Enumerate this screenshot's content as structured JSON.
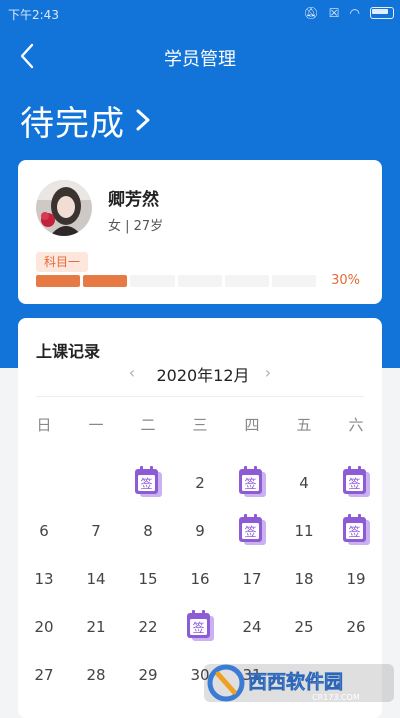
{
  "status_bar": {
    "time": "下午2:43"
  },
  "header": {
    "title": "学员管理"
  },
  "section": {
    "status_label": "待完成"
  },
  "student": {
    "name": "卿芳然",
    "info": "女 | 27岁",
    "subject": "科目一",
    "progress_percent": "30%",
    "progress_fraction": 0.3,
    "segments_total": 6,
    "segments_filled": 2
  },
  "records": {
    "title": "上课记录",
    "month": "2020年12月",
    "weekdays": [
      "日",
      "一",
      "二",
      "三",
      "四",
      "五",
      "六"
    ],
    "weeks": [
      [
        "",
        "",
        "1",
        "2",
        "3",
        "4",
        "5"
      ],
      [
        "6",
        "7",
        "8",
        "9",
        "10",
        "11",
        "12"
      ],
      [
        "13",
        "14",
        "15",
        "16",
        "17",
        "18",
        "19"
      ],
      [
        "20",
        "21",
        "22",
        "23",
        "24",
        "25",
        "26"
      ],
      [
        "27",
        "28",
        "29",
        "30",
        "31",
        "",
        ""
      ]
    ],
    "signed_days": [
      "1",
      "3",
      "5",
      "10",
      "12",
      "23"
    ],
    "sign_label": "签"
  },
  "watermark": {
    "text": "西西软件园",
    "subtext": "CR173.COM"
  },
  "colors": {
    "brand_blue": "#1274d8",
    "accent_orange": "#e77a44",
    "sign_purple": "#8e5bd6"
  },
  "icons": {
    "back": "chevron-left-icon",
    "forward": "chevron-right-icon"
  }
}
